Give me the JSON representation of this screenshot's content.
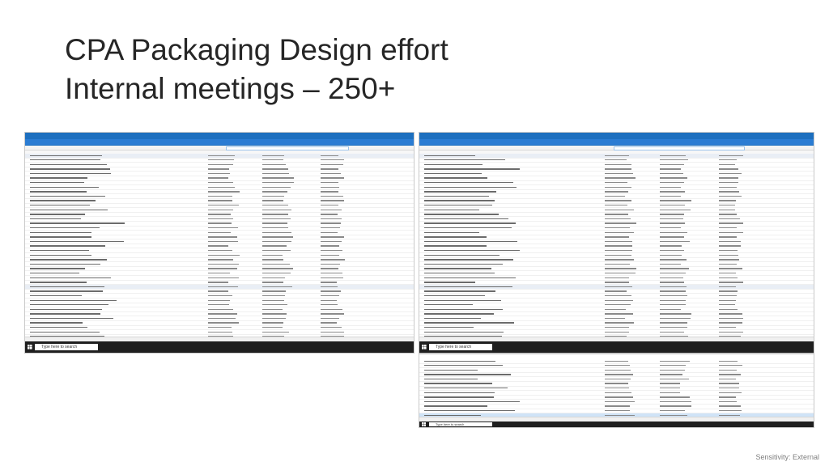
{
  "slide": {
    "title_line1": "CPA Packaging Design effort",
    "title_line2": "Internal meetings – 250+",
    "footer": "Sensitivity: External"
  },
  "screenshots": [
    {
      "taskbar_search": "Type here to search"
    },
    {
      "taskbar_search": "Type here to search"
    },
    {
      "taskbar_search": "Type here to search"
    }
  ],
  "icons": {
    "start": "windows-logo-icon"
  }
}
